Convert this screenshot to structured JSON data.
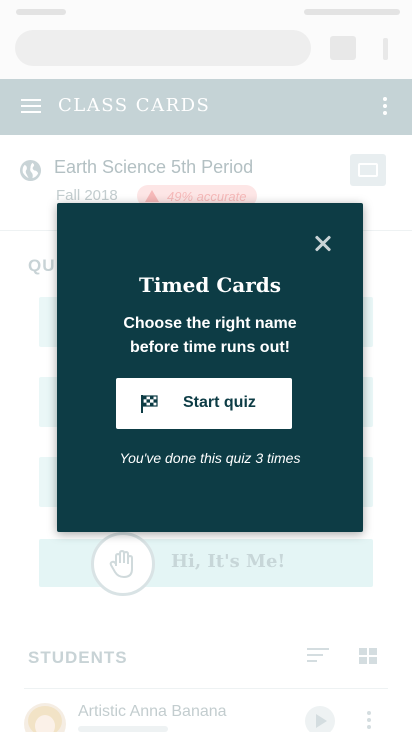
{
  "app": {
    "title": "CLASS CARDS"
  },
  "class_header": {
    "name": "Earth Science 5th Period",
    "term": "Fall 2018",
    "accuracy": "49% accurate"
  },
  "quizzes": {
    "heading": "QU",
    "hi_its_me_label": "Hi, It's Me!"
  },
  "students": {
    "heading": "STUDENTS",
    "items": [
      {
        "name": "Artistic Anna Banana"
      }
    ]
  },
  "modal": {
    "title": "Timed Cards",
    "description": "Choose the right name before time runs out!",
    "start_button": "Start quiz",
    "count_text": "You've done this quiz 3 times"
  },
  "icons": {
    "close": "close-icon",
    "flag": "checkered-flag-icon",
    "globe": "globe-icon",
    "hand": "hand-icon"
  },
  "colors": {
    "modal_bg": "#0d3c45",
    "appbar_bg": "#c5d3d6",
    "accent_light": "#eaf7f7"
  }
}
